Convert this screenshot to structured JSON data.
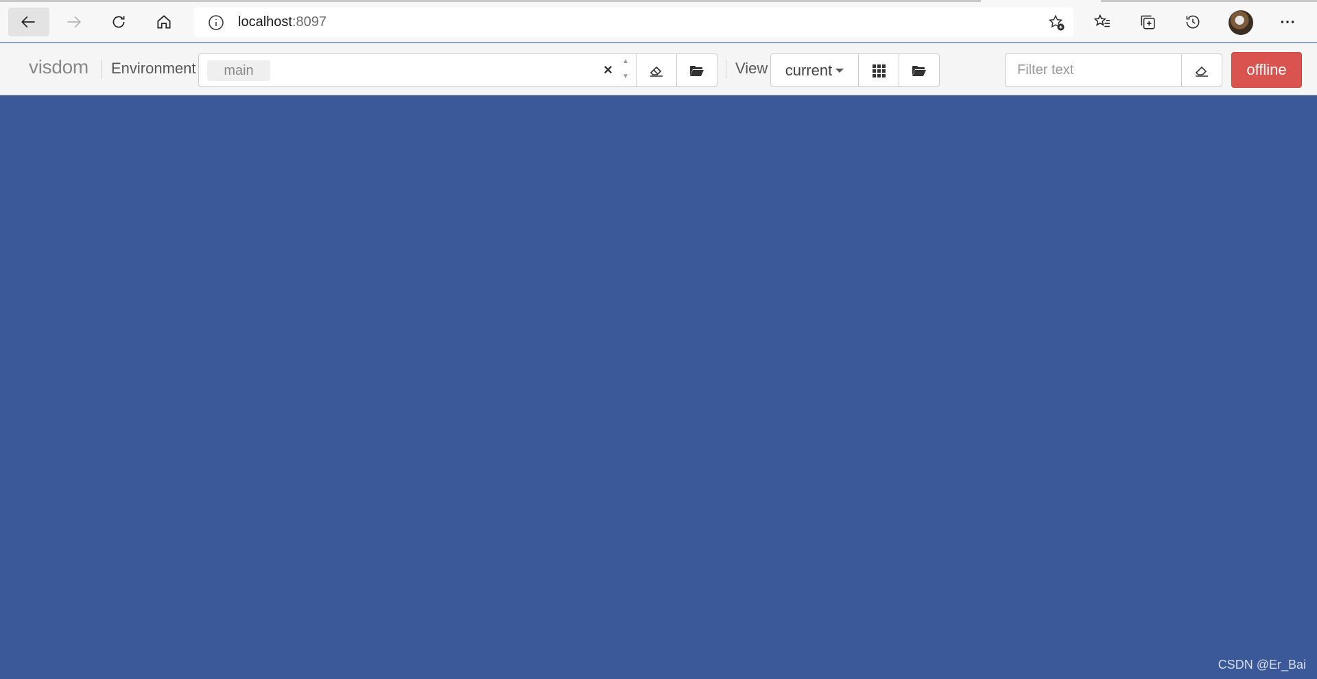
{
  "browser": {
    "url_host": "localhost",
    "url_port": ":8097",
    "icons": [
      "back-icon",
      "forward-icon",
      "refresh-icon",
      "home-icon",
      "info-icon",
      "add-favorite-icon",
      "favorites-icon",
      "collections-icon",
      "history-icon",
      "avatar",
      "more-icon"
    ]
  },
  "toolbar": {
    "brand": "visdom",
    "environment_label": "Environment",
    "environment_tag": "main",
    "clear_symbol": "×",
    "view_label": "View",
    "view_selected": "current",
    "filter_placeholder": "Filter text",
    "status_button": "offline"
  },
  "colors": {
    "canvas_background": "#3b5998",
    "offline_button": "#d9534f"
  },
  "watermark": "CSDN @Er_Bai"
}
